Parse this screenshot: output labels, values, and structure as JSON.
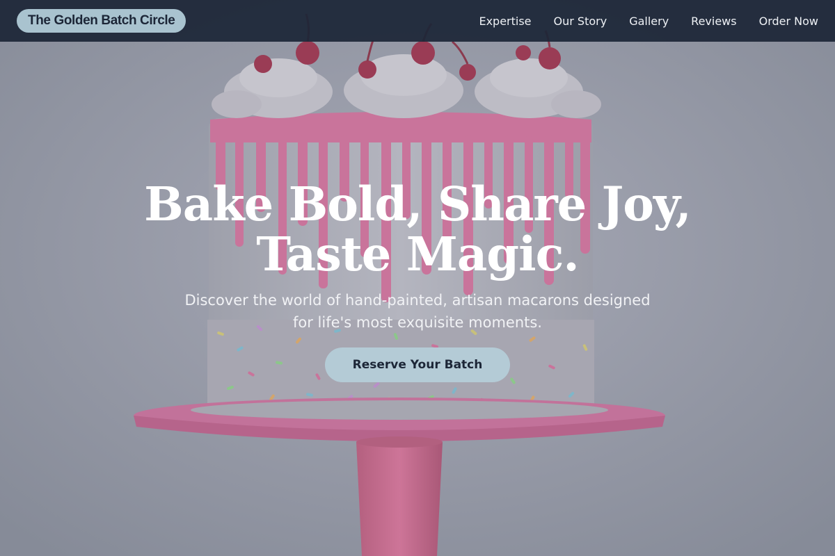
{
  "nav": {
    "brand": "The Golden Batch Circle",
    "links": [
      {
        "label": "Expertise"
      },
      {
        "label": "Our Story"
      },
      {
        "label": "Gallery"
      },
      {
        "label": "Reviews"
      },
      {
        "label": "Order Now"
      }
    ]
  },
  "hero": {
    "headline_line1": "Bake Bold, Share Joy,",
    "headline_line2": "Taste Magic.",
    "subtitle": "Discover the world of hand-painted, artisan macarons designed for life's most exquisite moments.",
    "cta_label": "Reserve Your Batch",
    "image_subject": "cake-photo"
  },
  "colors": {
    "nav_background": "#1c2637",
    "brand_pill": "#a9c3cf",
    "cta_background": "#b4cbd6",
    "cake_pink": "#d98bb4",
    "overlay": "#8f93a0"
  }
}
